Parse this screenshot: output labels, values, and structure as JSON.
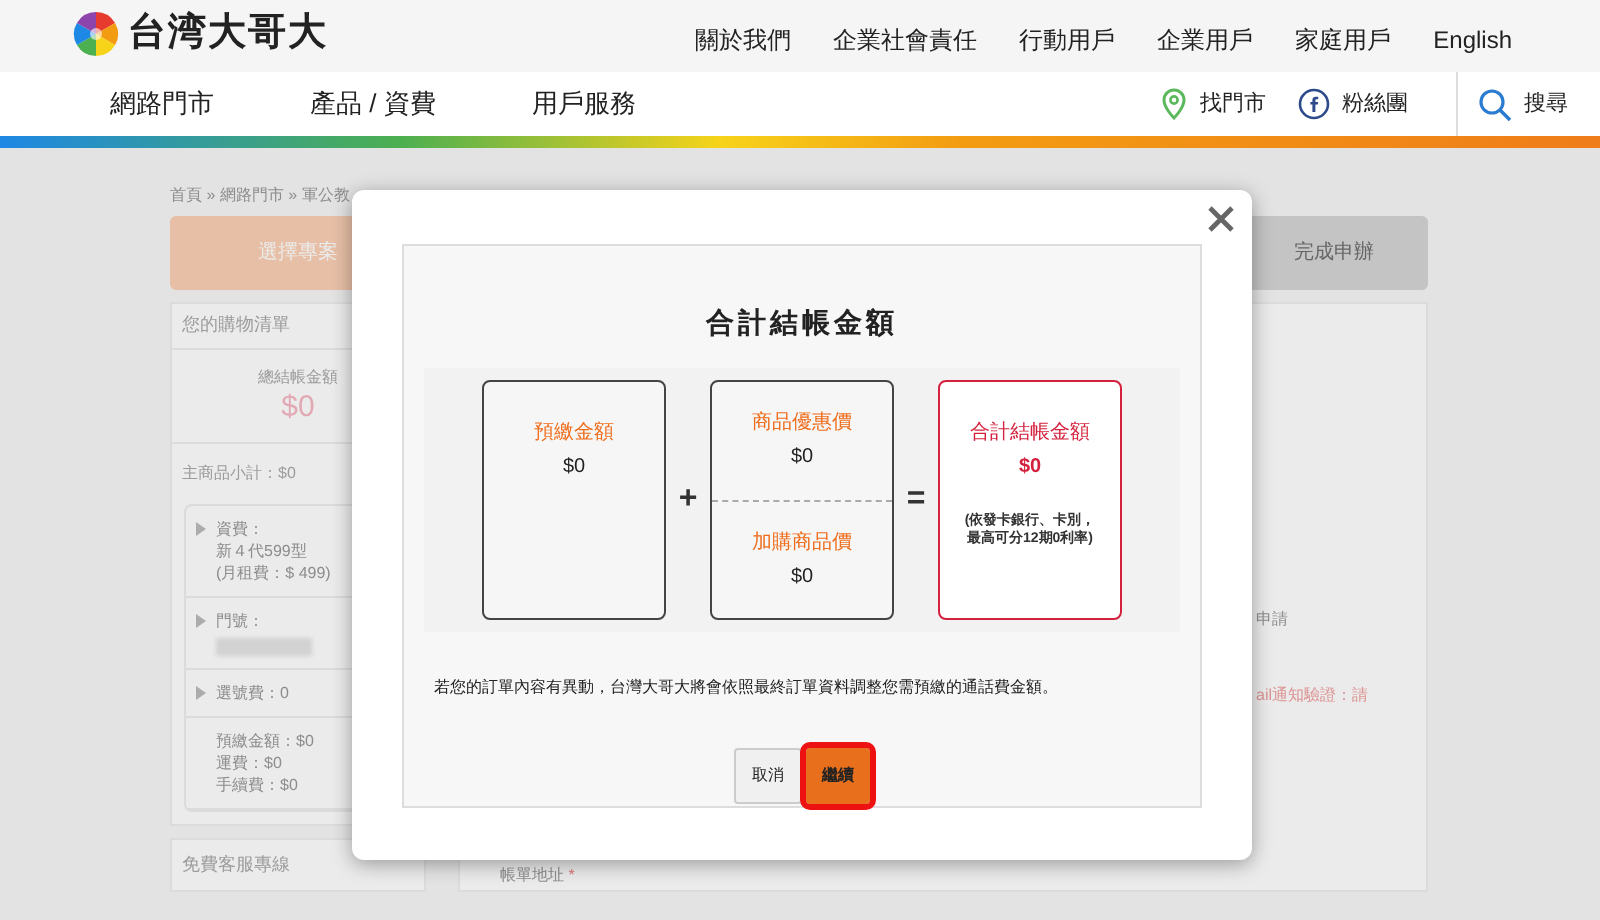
{
  "header": {
    "logo_text": "台湾大哥大",
    "top_links": [
      "關於我們",
      "企業社會責任",
      "行動用戶",
      "企業用戶",
      "家庭用戶",
      "English"
    ],
    "nav": [
      "網路門市",
      "產品 / 資費",
      "用戶服務"
    ],
    "utility": [
      {
        "kind": "store",
        "label": "找門市"
      },
      {
        "kind": "facebook",
        "label": "粉絲團"
      },
      {
        "kind": "search",
        "label": "搜尋"
      }
    ]
  },
  "background": {
    "breadcrumb": "首頁 » 網路門市 » 軍公教",
    "steps": [
      {
        "label": "選擇專案",
        "selected": true
      },
      {
        "label": "完成申辦",
        "selected": false
      }
    ],
    "cart": {
      "title": "您的購物清單",
      "total_label": "總結帳金額",
      "total": "$0",
      "subtotal": "主商品小計：$0",
      "sections": [
        {
          "expandable": true,
          "lines": [
            "資費：",
            "新４代599型",
            "(月租費：$ 499)"
          ]
        },
        {
          "expandable": true,
          "lines": [
            "門號："
          ],
          "blurred": true
        },
        {
          "expandable": true,
          "lines": [
            "選號費：0"
          ]
        },
        {
          "expandable": false,
          "lines": [
            "預繳金額：$0",
            "運費：$0",
            "手續費：$0"
          ]
        }
      ]
    },
    "hotline": "免費客服專線",
    "form_fragments": [
      "申請",
      "ail通知驗證：請"
    ],
    "address_label": {
      "label": "帳單地址",
      "required_mark": "*"
    }
  },
  "modal": {
    "title": "合計結帳金額",
    "terms": [
      {
        "kind": "plain",
        "parts": [
          {
            "label": "預繳金額",
            "amount": "$0"
          }
        ]
      },
      {
        "kind": "operator",
        "symbol": "+"
      },
      {
        "kind": "plain",
        "parts": [
          {
            "label": "商品優惠價",
            "amount": "$0"
          },
          {
            "label": "加購商品價",
            "amount": "$0"
          }
        ]
      },
      {
        "kind": "operator",
        "symbol": "="
      },
      {
        "kind": "total",
        "parts": [
          {
            "label": "合計結帳金額",
            "amount": "$0",
            "note": "(依發卡銀行、卡別，最高可分12期0利率)"
          }
        ]
      }
    ],
    "note": "若您的訂單內容有異動，台灣大哥大將會依照最終訂單資料調整您需預繳的通話費金額。",
    "buttons": [
      {
        "label": "取消",
        "kind": "secondary",
        "highlighted": false
      },
      {
        "label": "繼續",
        "kind": "primary",
        "highlighted": true
      }
    ]
  }
}
